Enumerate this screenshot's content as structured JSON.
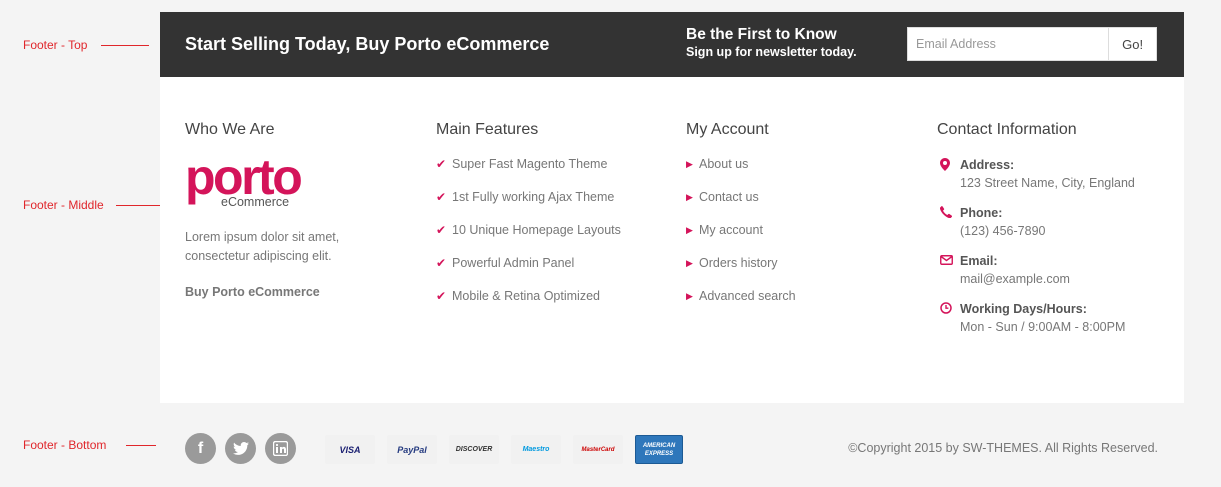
{
  "annotations": {
    "top": "Footer - Top",
    "middle": "Footer - Middle",
    "bottom": "Footer - Bottom"
  },
  "footer_top": {
    "slogan": "Start Selling Today, Buy Porto eCommerce",
    "newsletter_title": "Be the First to Know",
    "newsletter_subtitle": "Sign up for newsletter today.",
    "email_placeholder": "Email Address",
    "submit_label": "Go!"
  },
  "who_we_are": {
    "title": "Who We Are",
    "logo_word": "porto",
    "logo_sub": "eCommerce",
    "text": "Lorem ipsum dolor sit amet, consectetur adipiscing elit.",
    "link": "Buy Porto eCommerce"
  },
  "main_features": {
    "title": "Main Features",
    "items": [
      "Super Fast Magento Theme",
      "1st Fully working Ajax Theme",
      "10 Unique Homepage Layouts",
      "Powerful Admin Panel",
      "Mobile & Retina Optimized"
    ]
  },
  "my_account": {
    "title": "My Account",
    "items": [
      "About us",
      "Contact us",
      "My account",
      "Orders history",
      "Advanced search"
    ]
  },
  "contact": {
    "title": "Contact Information",
    "items": [
      {
        "icon": "map-marker-icon",
        "label": "Address:",
        "value": "123 Street Name, City, England"
      },
      {
        "icon": "phone-icon",
        "label": "Phone:",
        "value": "(123) 456-7890"
      },
      {
        "icon": "envelope-icon",
        "label": "Email:",
        "value": "mail@example.com"
      },
      {
        "icon": "clock-icon",
        "label": "Working Days/Hours:",
        "value": "Mon - Sun / 9:00AM - 8:00PM"
      }
    ]
  },
  "footer_bottom": {
    "social": [
      {
        "icon": "facebook-icon",
        "glyph": "f"
      },
      {
        "icon": "twitter-icon",
        "glyph": "t"
      },
      {
        "icon": "linkedin-icon",
        "glyph": "in"
      }
    ],
    "payments": [
      {
        "name": "visa-card",
        "text": "VISA",
        "bg": "#f1f1f1",
        "color": "#1a1f71"
      },
      {
        "name": "paypal-card",
        "text": "PayPal",
        "bg": "#f1f1f1",
        "color": "#253b80"
      },
      {
        "name": "discover-card",
        "text": "DISCOVER",
        "bg": "#f1f1f1",
        "color": "#333333"
      },
      {
        "name": "maestro-card",
        "text": "Maestro",
        "bg": "#f1f1f1",
        "color": "#0099df"
      },
      {
        "name": "mastercard-card",
        "text": "MasterCard",
        "bg": "#f1f1f1",
        "color": "#cc0000"
      },
      {
        "name": "amex-card",
        "text": "AMERICAN EXPRESS",
        "bg": "#2e77bb",
        "color": "#ffffff"
      }
    ],
    "copyright": "©Copyright 2015 by SW-THEMES. All Rights Reserved."
  },
  "colors": {
    "accent": "#d4145a",
    "top_bar": "#333333",
    "annotation": "#e0262b"
  }
}
